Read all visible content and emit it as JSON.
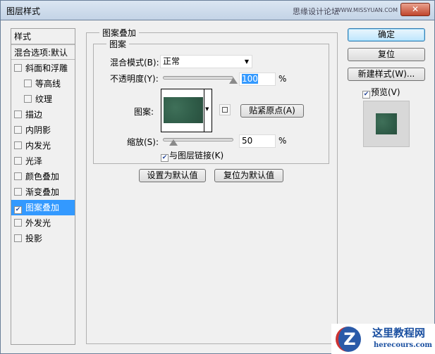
{
  "window": {
    "title": "图层样式",
    "watermark": "思缘设计论坛",
    "watermark_url": "WWW.MISSYUAN.COM",
    "close": "✕"
  },
  "styles_list": {
    "header": "样式",
    "blend_default": "混合选项:默认",
    "items": [
      {
        "label": "斜面和浮雕",
        "checked": false,
        "indent": false
      },
      {
        "label": "等高线",
        "checked": false,
        "indent": true
      },
      {
        "label": "纹理",
        "checked": false,
        "indent": true
      },
      {
        "label": "描边",
        "checked": false,
        "indent": false
      },
      {
        "label": "内阴影",
        "checked": false,
        "indent": false
      },
      {
        "label": "内发光",
        "checked": false,
        "indent": false
      },
      {
        "label": "光泽",
        "checked": false,
        "indent": false
      },
      {
        "label": "颜色叠加",
        "checked": false,
        "indent": false
      },
      {
        "label": "渐变叠加",
        "checked": false,
        "indent": false
      },
      {
        "label": "图案叠加",
        "checked": true,
        "indent": false,
        "selected": true
      },
      {
        "label": "外发光",
        "checked": false,
        "indent": false
      },
      {
        "label": "投影",
        "checked": false,
        "indent": false
      }
    ]
  },
  "panel": {
    "title": "图案叠加",
    "group": "图案",
    "blend_label": "混合模式(B):",
    "blend_value": "正常",
    "opacity_label": "不透明度(Y):",
    "opacity_value": "100",
    "opacity_percent": 100,
    "pattern_label": "图案:",
    "snap_button": "贴紧原点(A)",
    "scale_label": "缩放(S):",
    "scale_value": "50",
    "scale_percent": 50,
    "link_label": "与图层链接(K)",
    "link_checked": true,
    "unit": "%",
    "set_default": "设置为默认值",
    "reset_default": "复位为默认值"
  },
  "buttons": {
    "ok": "确定",
    "reset": "复位",
    "new_style": "新建样式(W)...",
    "preview": "预览(V)",
    "preview_checked": true
  },
  "logo": {
    "name": "这里教程网",
    "url": "herecours.com"
  }
}
